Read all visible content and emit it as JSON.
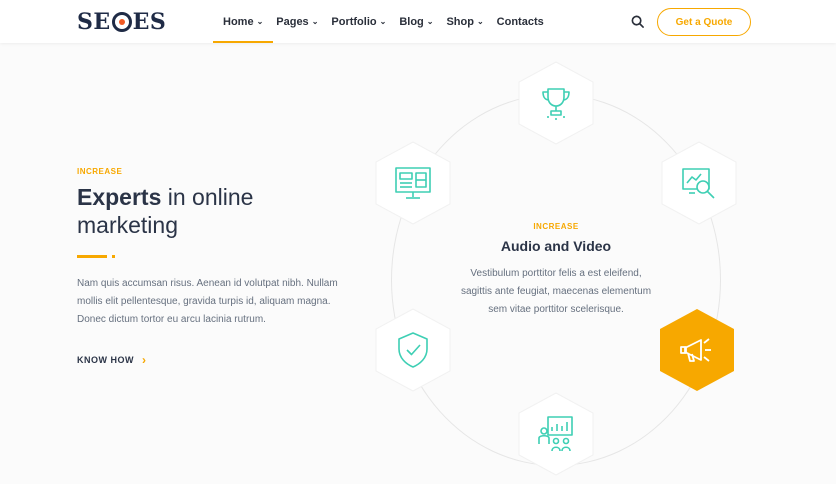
{
  "brand": {
    "logo_left": "SE",
    "logo_right": "ES"
  },
  "nav": {
    "items": [
      {
        "label": "Home",
        "has_dropdown": true,
        "active": true
      },
      {
        "label": "Pages",
        "has_dropdown": true
      },
      {
        "label": "Portfolio",
        "has_dropdown": true
      },
      {
        "label": "Blog",
        "has_dropdown": true
      },
      {
        "label": "Shop",
        "has_dropdown": true
      },
      {
        "label": "Contacts",
        "has_dropdown": false
      }
    ],
    "chevron": "⌄"
  },
  "header": {
    "quote_label": "Get a Quote",
    "search_icon": "search-icon"
  },
  "hero": {
    "eyebrow": "INCREASE",
    "headline_bold": "Experts",
    "headline_rest": " in online marketing",
    "body": "Nam quis accumsan risus. Aenean id volutpat nibh. Nullam mollis elit pellentesque, gravida turpis id, aliquam magna. Donec dictum tortor eu arcu lacinia rutrum.",
    "link_label": "KNOW HOW",
    "link_arrow": "›"
  },
  "feature": {
    "eyebrow": "INCREASE",
    "title": "Audio and Video",
    "text": "Vestibulum porttitor felis a est eleifend, sagittis ante feugiat, maecenas elementum sem vitae porttitor scelerisque."
  },
  "colors": {
    "accent": "#f7a800",
    "icon": "#3ecfb4",
    "dark": "#2b3447"
  },
  "icons": [
    "trophy-icon",
    "analytics-search-icon",
    "megaphone-icon",
    "presentation-icon",
    "shield-check-icon",
    "dashboard-monitor-icon"
  ]
}
